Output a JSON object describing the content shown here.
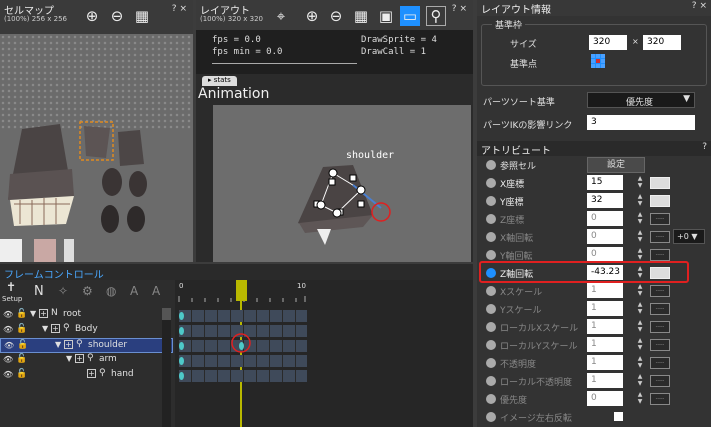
{
  "cellmap": {
    "title": "セルマップ",
    "size": "(100%) 256 x 256",
    "help": "?",
    "close": "×"
  },
  "layout": {
    "title": "レイアウト",
    "size": "(100%) 320 x 320",
    "help": "?",
    "close": "×",
    "stats_lines": [
      "fps = 0.0",
      "fps min = 0.0"
    ],
    "stats_right": [
      "DrawSprite = 4",
      "DrawCall = 1"
    ],
    "stats_tab": "stats",
    "animation_label": "Animation",
    "bone_label": "shoulder"
  },
  "info": {
    "title": "レイアウト情報",
    "help": "?",
    "close": "×",
    "frame_group": "基準枠",
    "size_label": "サイズ",
    "width": "320",
    "times": "×",
    "height": "320",
    "origin_label": "基準点",
    "sort_label": "パーツソート基準",
    "sort_value": "優先度",
    "ik_label": "パーツIKの影響リンク",
    "ik_value": "3"
  },
  "attr": {
    "title": "アトリビュート",
    "help": "?",
    "ref_cell": "参照セル",
    "set_button": "設定",
    "rows": [
      {
        "label": "X座標",
        "value": "15",
        "active": true
      },
      {
        "label": "Y座標",
        "value": "32",
        "active": true
      },
      {
        "label": "Z座標",
        "value": "0",
        "active": false
      },
      {
        "label": "X軸回転",
        "value": "0",
        "active": false
      },
      {
        "label": "Y軸回転",
        "value": "0",
        "active": false
      },
      {
        "label": "Z軸回転",
        "value": "-43.23",
        "active": true
      },
      {
        "label": "Xスケール",
        "value": "1",
        "active": false
      },
      {
        "label": "Yスケール",
        "value": "1",
        "active": false
      },
      {
        "label": "ローカルXスケール",
        "value": "1",
        "active": false
      },
      {
        "label": "ローカルYスケール",
        "value": "1",
        "active": false
      },
      {
        "label": "不透明度",
        "value": "1",
        "active": false
      },
      {
        "label": "ローカル不透明度",
        "value": "1",
        "active": false
      },
      {
        "label": "優先度",
        "value": "0",
        "active": false
      },
      {
        "label": "イメージ左右反転",
        "value": "",
        "active": false
      }
    ],
    "xrot_extra": "+0"
  },
  "frame": {
    "title": "フレームコントロール",
    "setup_label": "Setup",
    "ruler_start": "0",
    "ruler_end": "10",
    "tree": [
      {
        "name": "root",
        "indent": 0
      },
      {
        "name": "Body",
        "indent": 1
      },
      {
        "name": "shoulder",
        "indent": 2
      },
      {
        "name": "arm",
        "indent": 3
      },
      {
        "name": "hand",
        "indent": 4
      }
    ]
  },
  "colors": {
    "accent": "#1e90ff",
    "highlight_red": "#e02020",
    "playhead": "#b8b800",
    "selection": "#2a3f7f"
  }
}
